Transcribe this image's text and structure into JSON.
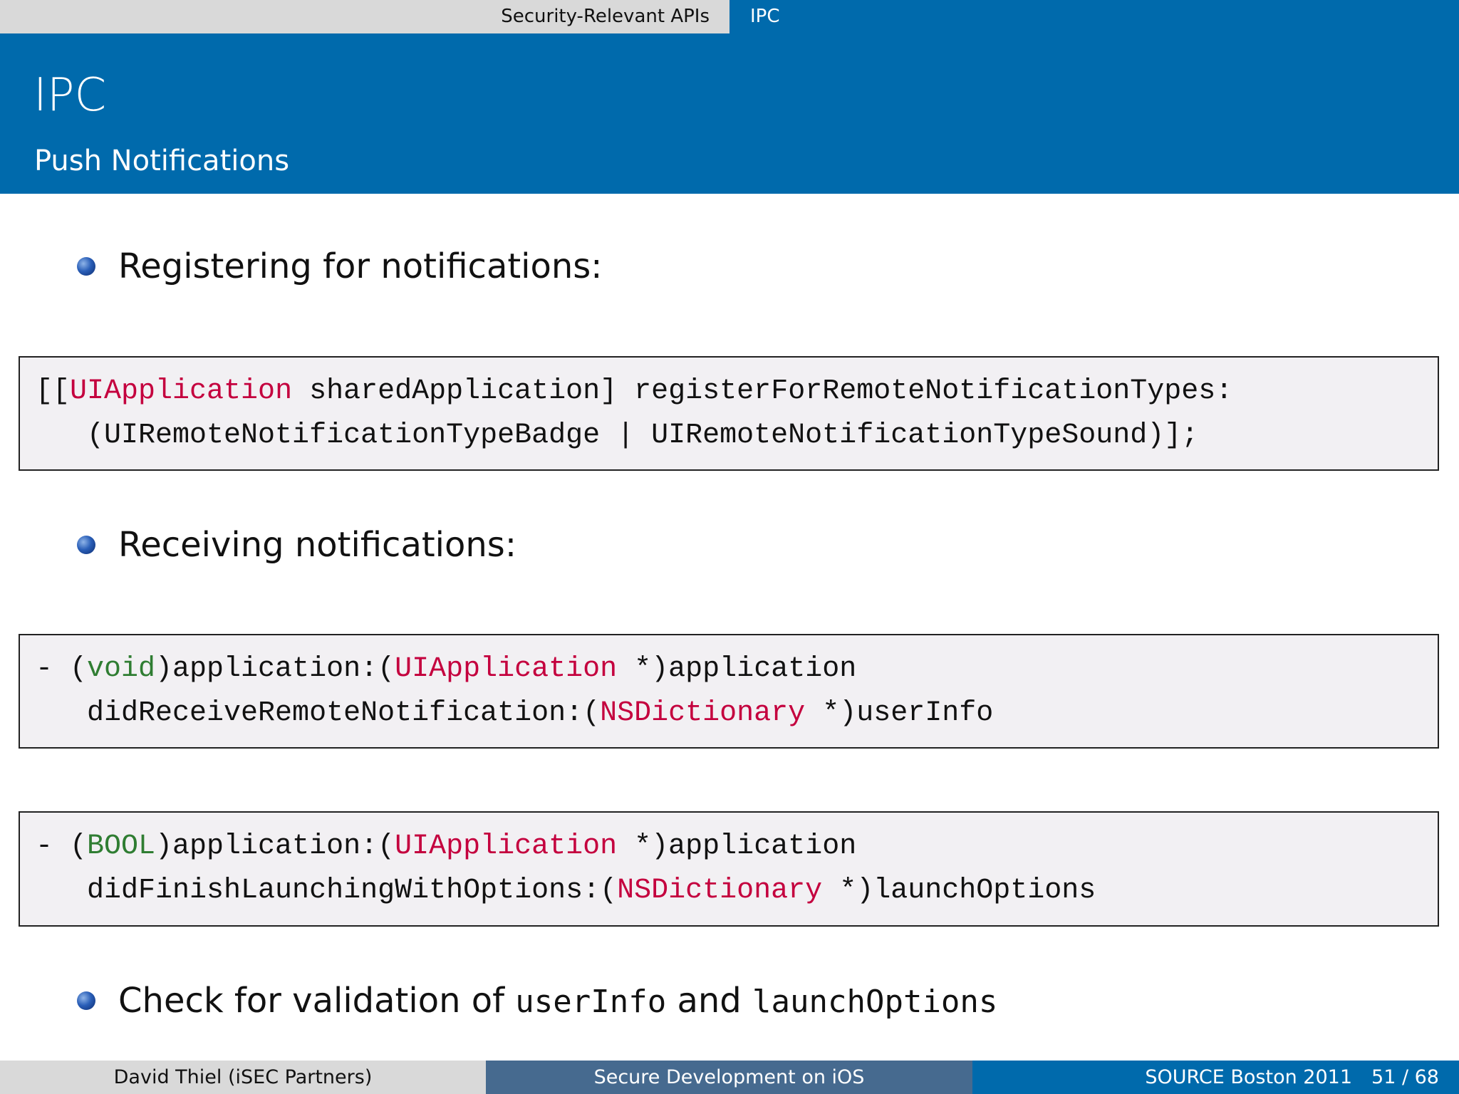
{
  "nav": {
    "section": "Security-Relevant APIs",
    "subsection": "IPC"
  },
  "header": {
    "title": "IPC",
    "subtitle": "Push Notifications"
  },
  "bullets": [
    {
      "text": "Registering for notifications:"
    },
    {
      "text": "Receiving notifications:"
    },
    {
      "text_before": "Check for validation of ",
      "code1": "userInfo",
      "text_mid": " and ",
      "code2": "launchOptions"
    }
  ],
  "code_blocks": [
    {
      "lines": [
        [
          [
            "[[",
            ""
          ],
          [
            "UIApplication",
            "kw"
          ],
          [
            " sharedApplication] registerForRemoteNotificationTypes:",
            ""
          ]
        ],
        [
          [
            "   (UIRemoteNotificationTypeBadge | UIRemoteNotificationTypeSound)];",
            ""
          ]
        ]
      ]
    },
    {
      "lines": [
        [
          [
            "- (",
            ""
          ],
          [
            "void",
            "ty"
          ],
          [
            ")application:(",
            ""
          ],
          [
            "UIApplication",
            "kw"
          ],
          [
            " *)application",
            ""
          ]
        ],
        [
          [
            "   didReceiveRemoteNotification:(",
            ""
          ],
          [
            "NSDictionary",
            "kw"
          ],
          [
            " *)userInfo",
            ""
          ]
        ]
      ]
    },
    {
      "lines": [
        [
          [
            "- (",
            ""
          ],
          [
            "BOOL",
            "ty"
          ],
          [
            ")application:(",
            ""
          ],
          [
            "UIApplication",
            "kw"
          ],
          [
            " *)application",
            ""
          ]
        ],
        [
          [
            "   didFinishLaunchingWithOptions:(",
            ""
          ],
          [
            "NSDictionary",
            "kw"
          ],
          [
            " *)launchOptions",
            ""
          ]
        ]
      ]
    }
  ],
  "footer": {
    "author": "David Thiel  (iSEC Partners)",
    "talk": "Secure Development on iOS",
    "conference": "SOURCE Boston 2011",
    "page": "51 / 68"
  },
  "colors": {
    "brand_blue": "#006aac",
    "keyword_red": "#c4003e",
    "type_green": "#2f7d32",
    "code_bg": "#f2f0f3"
  }
}
